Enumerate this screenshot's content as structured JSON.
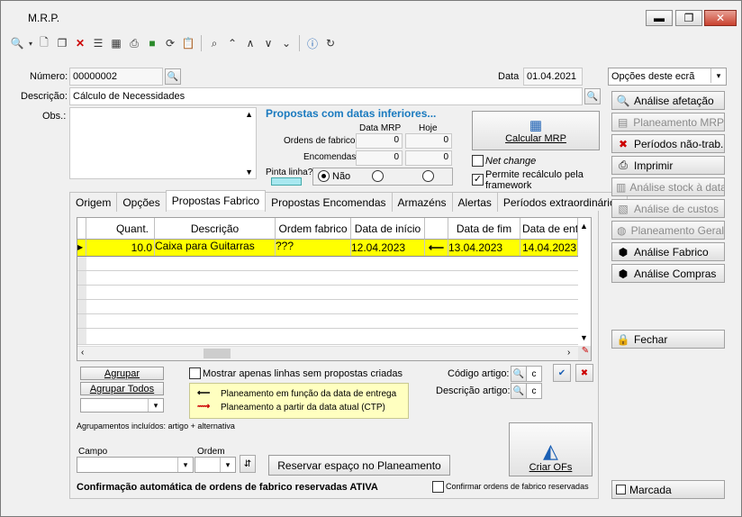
{
  "window": {
    "title": "M.R.P.",
    "min": "▬",
    "max": "❐",
    "close": "✕"
  },
  "toolbar": [
    "search-icon",
    "dropdown-icon",
    "new-icon",
    "copy-icon",
    "delete-icon",
    "list-icon",
    "grid-icon",
    "print-icon",
    "folder-icon",
    "refresh-icon",
    "clipboard-icon",
    "find-icon",
    "first-icon",
    "previous-icon",
    "next-icon",
    "last-icon",
    "help-icon",
    "reload-icon"
  ],
  "header": {
    "numero_label": "Número:",
    "numero_value": "00000002",
    "data_label": "Data",
    "data_value": "01.04.2021",
    "opcoes_combo": "Opções deste ecrã",
    "descricao_label": "Descrição:",
    "descricao_value": "Cálculo de Necessidades",
    "obs_label": "Obs.:"
  },
  "propostas": {
    "title": "Propostas com datas inferiores...",
    "col_mrp": "Data MRP",
    "col_hoje": "Hoje",
    "row1_label": "Ordens de fabrico",
    "row1_mrp": "0",
    "row1_hoje": "0",
    "row2_label": "Encomendas",
    "row2_mrp": "0",
    "row2_hoje": "0",
    "pinta_linha": "Pinta linha?",
    "radio_nao": "Não"
  },
  "calcular_mrp": "Calcular MRP",
  "net_change": "Net change",
  "permite": "Permite recálculo pela framework",
  "tabs": [
    "Origem",
    "Opções",
    "Propostas Fabrico",
    "Propostas Encomendas",
    "Armazéns",
    "Alertas",
    "Períodos extraordinários"
  ],
  "grid": {
    "headers": [
      "Quant.",
      "Descrição",
      "Ordem fabrico",
      "Data de início",
      "",
      "Data de fim",
      "Data de entre"
    ],
    "row": [
      "10.0",
      "Caixa para Guitarras",
      "???",
      "12.04.2023",
      "13.04.2023",
      "14.04.2023"
    ]
  },
  "right_buttons": [
    {
      "label": "Análise afetação",
      "icon": "search-doc-icon",
      "enabled": true
    },
    {
      "label": "Planeamento MRP",
      "icon": "planning-icon",
      "enabled": false
    },
    {
      "label": "Períodos não-trab.",
      "icon": "calendar-x-icon",
      "enabled": true
    },
    {
      "label": "Imprimir",
      "icon": "print-icon",
      "enabled": true
    },
    {
      "label": "Análise stock à data",
      "icon": "stock-icon",
      "enabled": false
    },
    {
      "label": "Análise de custos",
      "icon": "cost-icon",
      "enabled": false
    },
    {
      "label": "Planeamento Geral",
      "icon": "globe-icon",
      "enabled": false
    },
    {
      "label": "Análise Fabrico",
      "icon": "box-icon",
      "enabled": true
    },
    {
      "label": "Análise Compras",
      "icon": "box-icon",
      "enabled": true
    }
  ],
  "fechar": "Fechar",
  "marcada": "Marcada",
  "bottom": {
    "agrupar": "Agrupar",
    "agrupar_todos": "Agrupar Todos",
    "mostrar": "Mostrar apenas linhas sem propostas criadas",
    "codigo_artigo": "Código artigo:",
    "descricao_artigo": "Descrição artigo:",
    "legend1": "Planeamento em função da data de entrega",
    "legend2": "Planeamento a partir da data atual (CTP)",
    "agrupamentos": "Agrupamentos incluídos: artigo + alternativa",
    "campo": "Campo",
    "ordem": "Ordem",
    "reservar": "Reservar espaço no Planeamento",
    "criar": "Criar OFs",
    "confirmacao": "Confirmação automática de ordens de fabrico reservadas ATIVA",
    "confirmar": "Confirmar ordens de fabrico reservadas"
  },
  "colors": {
    "highlight_row": "#ffff00",
    "propostas_title": "#1a7abf",
    "pinta_swatch": "#a8e8f0"
  }
}
